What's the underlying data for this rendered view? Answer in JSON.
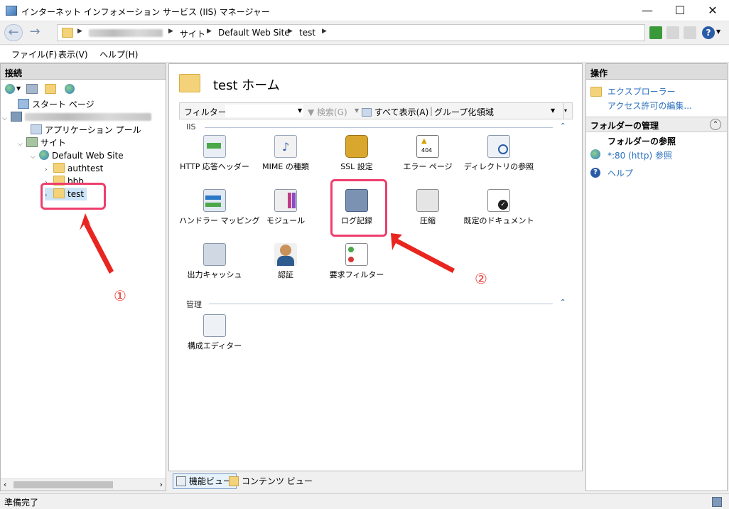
{
  "window": {
    "title": "インターネット インフォメーション サービス (IIS) マネージャー",
    "minimize": "—",
    "maximize": "☐",
    "close": "✕"
  },
  "address": {
    "segments": [
      "サイト",
      "Default Web Site",
      "test"
    ]
  },
  "menu": [
    "ファイル(F)",
    "表示(V)",
    "ヘルプ(H)"
  ],
  "connections": {
    "header": "接続",
    "tree": {
      "start_page": "スタート ページ",
      "app_pools": "アプリケーション プール",
      "sites": "サイト",
      "default_site": "Default Web Site",
      "authtest": "authtest",
      "bbb": "bbb",
      "test": "test"
    }
  },
  "center": {
    "home_title": "test ホーム",
    "filter": {
      "label": "フィルター:",
      "search": "検索(G)",
      "show_all": "すべて表示(A)",
      "group_label": "グループ化:",
      "group_value": "領域"
    },
    "groups": [
      {
        "name": "IIS",
        "features": [
          {
            "label": "HTTP 応答ヘッダー",
            "icon": "http-headers-icon"
          },
          {
            "label": "MIME の種類",
            "icon": "mime-types-icon"
          },
          {
            "label": "SSL 設定",
            "icon": "ssl-lock-icon"
          },
          {
            "label": "エラー ページ",
            "icon": "error-pages-icon"
          },
          {
            "label": "ディレクトリの参照",
            "icon": "directory-browsing-icon"
          },
          {
            "label": "ハンドラー マッピング",
            "icon": "handler-mappings-icon"
          },
          {
            "label": "モジュール",
            "icon": "modules-icon"
          },
          {
            "label": "ログ記録",
            "icon": "logging-icon"
          },
          {
            "label": "圧縮",
            "icon": "compression-icon"
          },
          {
            "label": "既定のドキュメント",
            "icon": "default-document-icon"
          },
          {
            "label": "出力キャッシュ",
            "icon": "output-caching-icon"
          },
          {
            "label": "認証",
            "icon": "authentication-icon"
          },
          {
            "label": "要求フィルター",
            "icon": "request-filtering-icon"
          }
        ]
      },
      {
        "name": "管理",
        "features": [
          {
            "label": "構成エディター",
            "icon": "configuration-editor-icon"
          }
        ]
      }
    ],
    "error_icon_text": "404",
    "view_tabs": {
      "features": "機能ビュー",
      "content": "コンテンツ ビュー"
    }
  },
  "actions": {
    "header": "操作",
    "explore": "エクスプローラー",
    "edit_permissions": "アクセス許可の編集...",
    "manage_folder": "フォルダーの管理",
    "browse_heading": "フォルダーの参照",
    "browse_link": "*:80 (http) 参照",
    "help": "ヘルプ"
  },
  "status": "準備完了",
  "annotations": {
    "one": "①",
    "two": "②"
  },
  "colors": {
    "highlight": "#ee3f6d",
    "arrow": "#e8251f",
    "link": "#2a6fbf"
  }
}
